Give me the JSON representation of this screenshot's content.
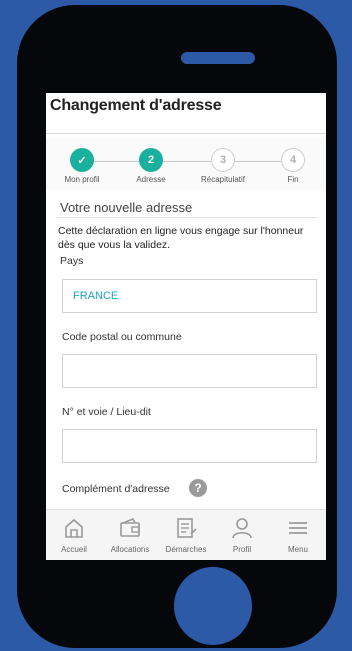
{
  "header": {
    "title": "Changement d'adresse"
  },
  "stepper": {
    "steps": [
      {
        "label": "Mon profil",
        "marker": "✓"
      },
      {
        "label": "Adresse",
        "marker": "2"
      },
      {
        "label": "Récapitulatif",
        "marker": "3"
      },
      {
        "label": "Fin",
        "marker": "4"
      }
    ]
  },
  "form": {
    "section_title": "Votre nouvelle adresse",
    "intro": "Cette déclaration en ligne vous engage sur l'honneur dès que vous la validez.",
    "country_label": "Pays",
    "country_value": "FRANCE",
    "postal_label": "Code postal ou commune",
    "postal_value": "",
    "street_label": "N° et voie / Lieu-dit",
    "street_value": "",
    "complement_label": "Complément d'adresse",
    "help_glyph": "?"
  },
  "nav": {
    "items": [
      {
        "label": "Accueil",
        "icon": "home-icon"
      },
      {
        "label": "Allocations",
        "icon": "wallet-icon"
      },
      {
        "label": "Démarches",
        "icon": "form-edit-icon"
      },
      {
        "label": "Profil",
        "icon": "user-icon"
      },
      {
        "label": "Menu",
        "icon": "menu-icon"
      }
    ]
  },
  "colors": {
    "background": "#2d5aa6",
    "phone": "#06070a",
    "accent": "#19b09d",
    "link": "#1aa3c8"
  }
}
